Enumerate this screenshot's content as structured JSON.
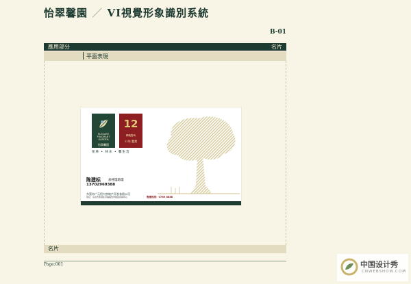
{
  "header": {
    "brand": "怡翠馨園",
    "system_title": "VI視覺形象識別系統",
    "page_code": "B-01"
  },
  "section_bar": {
    "left_label": "應用部分",
    "right_label": "名片"
  },
  "subtitle": "平面表現",
  "card": {
    "logo_green": {
      "english": "ELEGANT FRAGRANT GARDEN",
      "chinese": "怡翠馨園"
    },
    "logo_red": {
      "number": "12",
      "line1": "精裝智尚",
      "line2": "12年 鑑賞"
    },
    "tagline": "花林 • 林水 • 馨生活",
    "person_name": "陈建标",
    "person_title": "总经理助理",
    "phone": "13702969388",
    "company": "东莞市广元恒兴房地产开发有限公司",
    "address": "地址：东莞市南城区鸿福路怡翠馨园营销中心",
    "hotline": "售楼热线：0769 8888"
  },
  "footer": {
    "label": "名片",
    "page_number": "Page:001"
  },
  "watermark": {
    "chinese": "中国设计秀",
    "english": "CNWEBSHOW.COM"
  },
  "colors": {
    "dark_green": "#1e3b31",
    "beige": "#f8f4e6",
    "band": "#e4dcc0",
    "burgundy": "#8d1f23",
    "tree_tan": "#d9cfa6"
  }
}
